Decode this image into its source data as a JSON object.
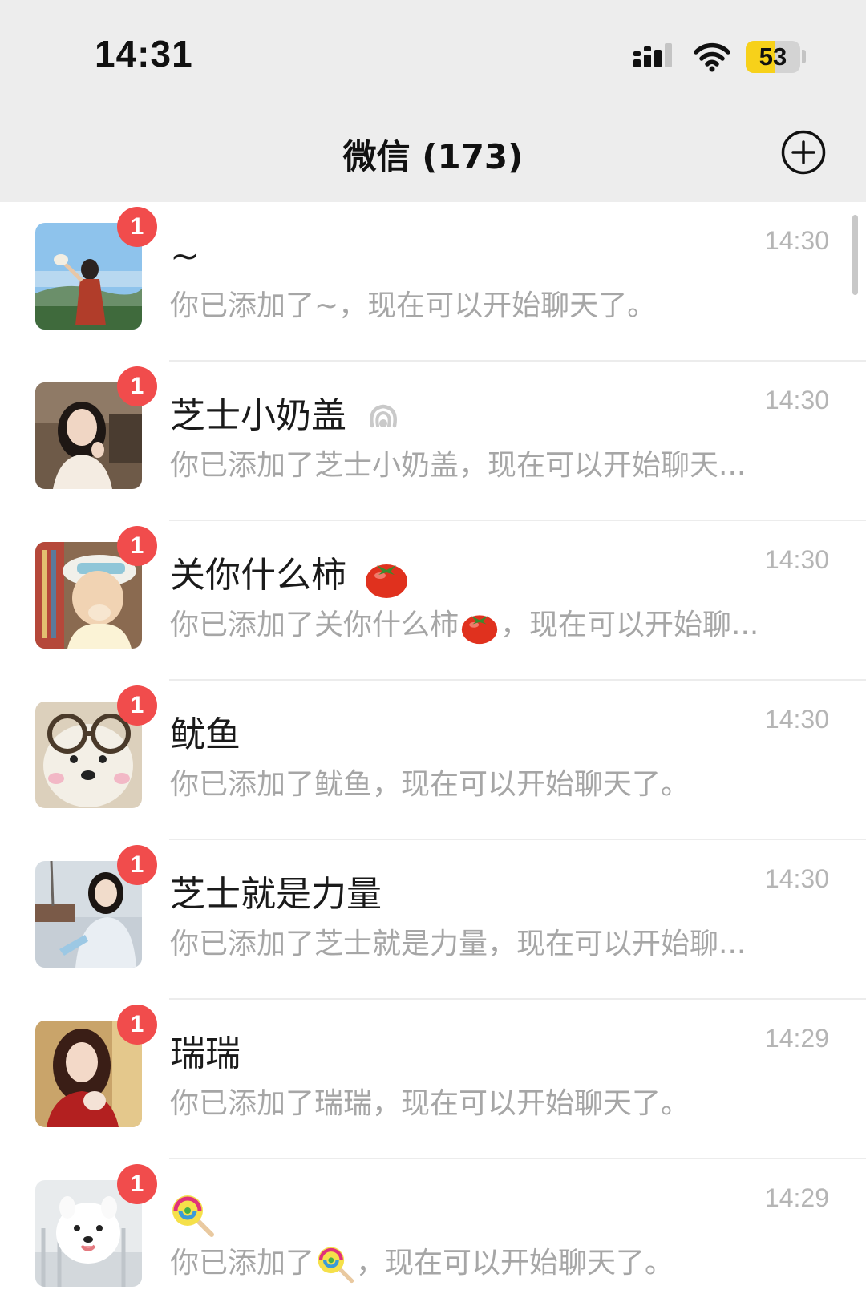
{
  "status_bar": {
    "time": "14:31",
    "battery_level": "53",
    "battery_fraction": 0.53
  },
  "nav": {
    "title": "微信 (173)",
    "add_icon": "plus-circle-icon"
  },
  "colors": {
    "badge": "#f14c4c",
    "header_bg": "#ededed",
    "battery_fill": "#f7d11a"
  },
  "chats": [
    {
      "name": "~",
      "time": "14:30",
      "unread": "1",
      "preview": "你已添加了~，现在可以开始聊天了。",
      "avatar": "avatar-girl-field"
    },
    {
      "name": "芝士小奶盖",
      "name_icon": "ear-icon",
      "time": "14:30",
      "unread": "1",
      "preview": "你已添加了芝士小奶盖，现在可以开始聊天...",
      "avatar": "avatar-girl-indoor"
    },
    {
      "name": "关你什么柿",
      "name_icon": "tomato-emoji",
      "time": "14:30",
      "unread": "1",
      "preview_before": "你已添加了关你什么柿",
      "preview_icon": "tomato-emoji",
      "preview_after": "，现在可以开始聊...",
      "avatar": "avatar-girl-hat"
    },
    {
      "name": "鱿鱼",
      "time": "14:30",
      "unread": "1",
      "preview": "你已添加了鱿鱼，现在可以开始聊天了。",
      "avatar": "avatar-bear-glasses"
    },
    {
      "name": "芝士就是力量",
      "time": "14:30",
      "unread": "1",
      "preview": "你已添加了芝士就是力量，现在可以开始聊...",
      "avatar": "avatar-girl-winter"
    },
    {
      "name": "瑞瑞",
      "time": "14:29",
      "unread": "1",
      "preview": "你已添加了瑞瑞，现在可以开始聊天了。",
      "avatar": "avatar-girl-red"
    },
    {
      "name": "",
      "name_icon": "lollipop-emoji",
      "time": "14:29",
      "unread": "1",
      "preview_before": "你已添加了",
      "preview_icon": "lollipop-emoji",
      "preview_after": "，现在可以开始聊天了。",
      "avatar": "avatar-white-dog"
    }
  ]
}
